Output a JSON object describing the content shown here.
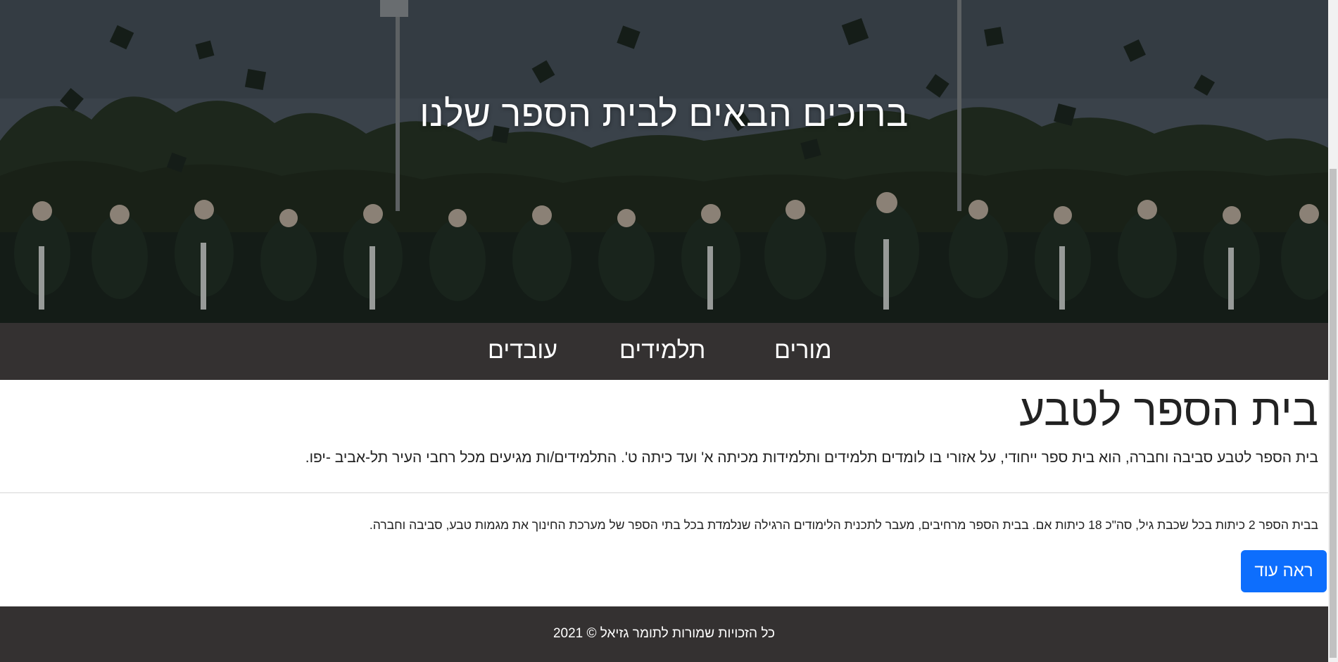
{
  "hero": {
    "title": "ברוכים הבאים לבית הספר שלנו"
  },
  "nav": {
    "items": [
      {
        "label": "מורים"
      },
      {
        "label": "תלמידים"
      },
      {
        "label": "עובדים"
      }
    ]
  },
  "main": {
    "title": "בית הספר לטבע",
    "lead": "בית הספר לטבע סביבה וחברה, הוא בית ספר ייחודי, על אזורי בו לומדים תלמידים ותלמידות מכיתה א' ועד כיתה ט'. התלמידים/ות מגיעים מכל רחבי העיר תל-אביב -יפו.",
    "body": "בבית הספר 2 כיתות בכל שכבת גיל, סה\"כ 18 כיתות אם. בבית הספר מרחיבים, מעבר לתכנית הלימודים הרגילה שנלמדת בכל בתי הספר של מערכת החינוך את מגמות טבע, סביבה וחברה.",
    "more_button": "ראה עוד"
  },
  "footer": {
    "text": "כל הזכויות שמורות לתומר גזיאל © 2021"
  },
  "colors": {
    "nav_bg": "#343131",
    "footer_bg": "#343131",
    "button_bg": "#0d6efd"
  }
}
